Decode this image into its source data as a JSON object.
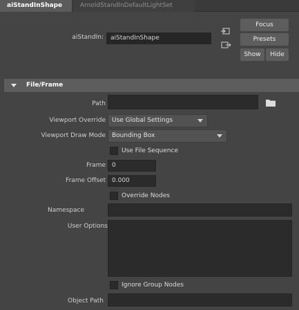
{
  "tabs": [
    {
      "label": "aiStandInShape"
    },
    {
      "label": "ArnoldStandInDefaultLightSet"
    }
  ],
  "header": {
    "node_label": "aiStandIn:",
    "node_value": "aiStandInShape",
    "focus": "Focus",
    "presets": "Presets",
    "show": "Show",
    "hide": "Hide"
  },
  "section": {
    "title": "File/Frame"
  },
  "fields": {
    "path_label": "Path",
    "path_value": "",
    "viewport_override_label": "Viewport Override",
    "viewport_override_value": "Use Global Settings",
    "viewport_draw_mode_label": "Viewport Draw Mode",
    "viewport_draw_mode_value": "Bounding Box",
    "use_file_sequence": "Use File Sequence",
    "frame_label": "Frame",
    "frame_value": "0",
    "frame_offset_label": "Frame Offset",
    "frame_offset_value": "0.000",
    "override_nodes": "Override Nodes",
    "namespace_label": "Namespace",
    "namespace_value": "",
    "user_options_label": "User Options",
    "user_options_value": "",
    "ignore_group_nodes": "Ignore Group Nodes",
    "object_path_label": "Object Path",
    "object_path_value": ""
  },
  "icons": {
    "input_connection": "input-connection-icon",
    "output_connection": "output-connection-icon",
    "folder": "folder-icon",
    "collapse": "triangle-down-icon"
  }
}
